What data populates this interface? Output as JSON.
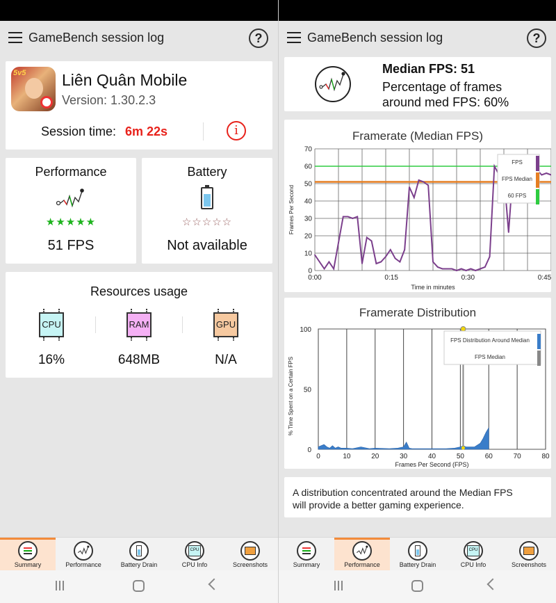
{
  "app_bar": {
    "title": "GameBench session log",
    "help_label": "?"
  },
  "summary": {
    "game_name": "Liên Quân Mobile",
    "version": "Version: 1.30.2.3",
    "session_label": "Session time:",
    "session_value": "6m 22s",
    "info_label": "i",
    "icon_text": "5v5",
    "performance": {
      "title": "Performance",
      "value": "51 FPS",
      "stars": "★★★★★"
    },
    "battery": {
      "title": "Battery",
      "value": "Not available",
      "stars": "☆☆☆☆☆"
    },
    "resources": {
      "title": "Resources usage",
      "items": [
        {
          "chip": "CPU",
          "value": "16%",
          "color": "#c6f4f4"
        },
        {
          "chip": "RAM",
          "value": "648MB",
          "color": "#f4b0f4"
        },
        {
          "chip": "GPU",
          "value": "N/A",
          "color": "#f6c9a0"
        }
      ]
    }
  },
  "performance_screen": {
    "median_title": "Median FPS: 51",
    "median_desc_line1": "Percentage of frames",
    "median_desc_line2": "around med FPS: 60%",
    "footer_line1": "A distribution concentrated around the Median FPS",
    "footer_line2": "will provide a better gaming experience."
  },
  "bottom_nav": [
    {
      "label": "Summary"
    },
    {
      "label": "Performance"
    },
    {
      "label": "Battery Drain"
    },
    {
      "label": "CPU Info"
    },
    {
      "label": "Screenshots"
    }
  ],
  "chip_label": "CPU",
  "chart_data": [
    {
      "type": "line",
      "title": "Framerate (Median FPS)",
      "xlabel": "Time in minutes",
      "ylabel": "Frames Per Second",
      "xlim": [
        0,
        50
      ],
      "ylim": [
        0,
        70
      ],
      "xticks": [
        "0:00",
        "0:15",
        "0:30",
        "0:45"
      ],
      "yticks": [
        "0",
        "10",
        "20",
        "30",
        "40",
        "50",
        "60",
        "70"
      ],
      "legend": [
        "FPS",
        "FPS Median",
        "60 FPS"
      ],
      "legend_colors": [
        "#7b3f8c",
        "#e67e22",
        "#2ecc40"
      ],
      "median": 51,
      "target": 60,
      "x": [
        0,
        1,
        2,
        3,
        4,
        5,
        6,
        7,
        8,
        9,
        10,
        11,
        12,
        13,
        14,
        15,
        16,
        17,
        18,
        19,
        20,
        21,
        22,
        23,
        24,
        25,
        26,
        27,
        28,
        29,
        30,
        31,
        32,
        33,
        34,
        35,
        36,
        37,
        38,
        39,
        40,
        41,
        42,
        43,
        44,
        45,
        46,
        47,
        48,
        49,
        50
      ],
      "values": [
        9,
        5,
        1,
        5,
        1,
        16,
        31,
        31,
        30,
        31,
        4,
        19,
        17,
        4,
        5,
        8,
        12,
        7,
        5,
        12,
        48,
        42,
        52,
        51,
        49,
        5,
        2,
        1,
        1,
        1,
        0,
        1,
        0,
        1,
        0,
        1,
        2,
        8,
        60,
        55,
        55,
        22,
        60,
        58,
        55,
        56,
        55,
        58,
        55,
        56,
        55
      ],
      "grid": true,
      "legend_position": "top-right"
    },
    {
      "type": "area",
      "title": "Framerate Distribution",
      "xlabel": "Frames Per Second (FPS)",
      "ylabel": "% Time Spent on a Certain FPS",
      "xlim": [
        0,
        80
      ],
      "ylim": [
        0,
        100
      ],
      "xticks": [
        "0",
        "10",
        "20",
        "30",
        "40",
        "50",
        "60",
        "70",
        "80"
      ],
      "yticks": [
        "0",
        "50",
        "100"
      ],
      "legend": [
        "FPS Distribution Around Median",
        "FPS Median"
      ],
      "legend_colors": [
        "#3a7dc9",
        "#888888"
      ],
      "median": 51,
      "x": [
        0,
        1,
        2,
        3,
        4,
        5,
        6,
        7,
        8,
        10,
        12,
        15,
        18,
        20,
        25,
        28,
        30,
        31,
        32,
        33,
        35,
        40,
        45,
        48,
        50,
        51,
        52,
        55,
        57,
        58,
        59,
        60
      ],
      "values": [
        2,
        3,
        4,
        2,
        1,
        3,
        1,
        2,
        1,
        1,
        0.5,
        2,
        0.5,
        1,
        0.5,
        1,
        2,
        6,
        1,
        0.5,
        0.5,
        0.5,
        0.5,
        1,
        2,
        3,
        2,
        2,
        5,
        9,
        14,
        18
      ],
      "grid": true,
      "legend_position": "top-right"
    }
  ]
}
